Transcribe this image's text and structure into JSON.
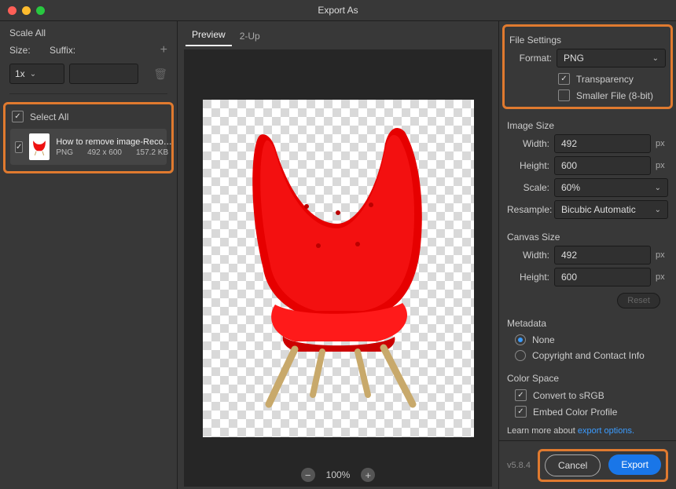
{
  "window": {
    "title": "Export As"
  },
  "scale_all": {
    "heading": "Scale All",
    "size_label": "Size:",
    "suffix_label": "Suffix:",
    "size_value": "1x"
  },
  "assets": {
    "select_all_label": "Select All",
    "item": {
      "name": "How to remove image-Recovered",
      "format": "PNG",
      "dimensions": "492 x 600",
      "filesize": "157.2 KB"
    }
  },
  "tabs": {
    "preview": "Preview",
    "two_up": "2-Up"
  },
  "zoom": {
    "percent": "100%"
  },
  "file_settings": {
    "title": "File Settings",
    "format_label": "Format:",
    "format_value": "PNG",
    "transparency_label": "Transparency",
    "smaller_label": "Smaller File (8-bit)"
  },
  "image_size": {
    "title": "Image Size",
    "width_label": "Width:",
    "width_value": "492",
    "height_label": "Height:",
    "height_value": "600",
    "scale_label": "Scale:",
    "scale_value": "60%",
    "resample_label": "Resample:",
    "resample_value": "Bicubic Automatic",
    "unit": "px"
  },
  "canvas_size": {
    "title": "Canvas Size",
    "width_label": "Width:",
    "width_value": "492",
    "height_label": "Height:",
    "height_value": "600",
    "unit": "px",
    "reset": "Reset"
  },
  "metadata": {
    "title": "Metadata",
    "none": "None",
    "contact": "Copyright and Contact Info"
  },
  "color_space": {
    "title": "Color Space",
    "convert": "Convert to sRGB",
    "embed": "Embed Color Profile"
  },
  "learn": {
    "prefix": "Learn more about ",
    "link": "export options."
  },
  "footer": {
    "version": "v5.8.4",
    "cancel": "Cancel",
    "export": "Export"
  }
}
